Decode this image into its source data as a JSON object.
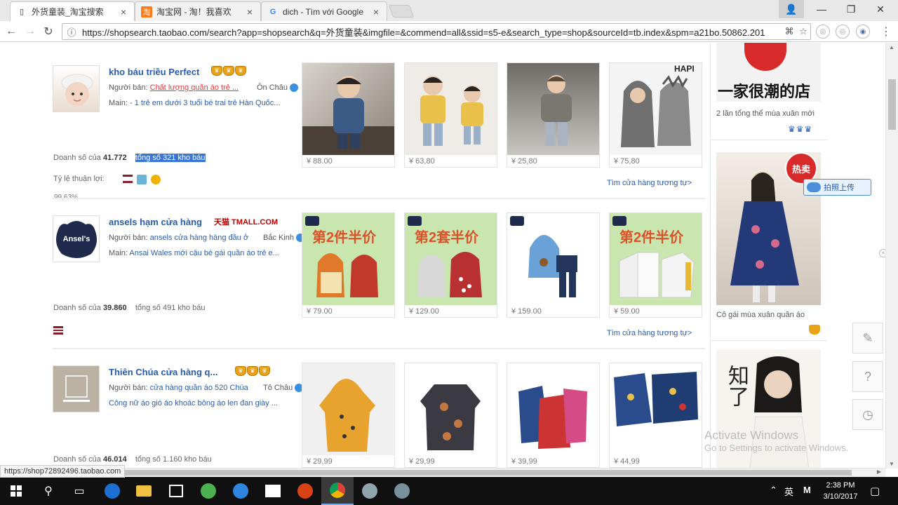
{
  "tabs": [
    {
      "title": "外货童装_淘宝搜索",
      "icon": "page-icon"
    },
    {
      "title": "淘宝网 - 淘！我喜欢",
      "icon": "taobao-icon"
    },
    {
      "title": "dich - Tìm với Google",
      "icon": "google-icon"
    }
  ],
  "address": {
    "url": "https://shopsearch.taobao.com/search?app=shopsearch&q=外货童装&imgfile=&commend=all&ssid=s5-e&search_type=shop&sourceId=tb.index&spm=a21bo.50862.201"
  },
  "shops": [
    {
      "name": "kho báu triều Perfect",
      "seller_label": "Người bán:",
      "seller": "Chất lượng quần áo trẻ ...",
      "location": "Ôn Châu",
      "main_label": "Main:",
      "main": "- 1 trẻ em dưới 3 tuổi bé trai trẻ Hàn Quốc...",
      "sales_label": "Doanh số của",
      "sales": "41.772",
      "total_text": "tổng số 321 kho báu",
      "rate_label": "Tỷ lệ thuận lợi:",
      "rate": "99,63%",
      "similar": "Tìm cửa hàng tương tự>",
      "products": [
        {
          "price": "¥ 88.00",
          "colors": [
            "#6b5a4a",
            "#3c5a86"
          ]
        },
        {
          "price": "¥ 63,80",
          "colors": [
            "#e9c04a",
            "#9ab0c8"
          ]
        },
        {
          "price": "¥ 25,80",
          "colors": [
            "#7a7670",
            "#a9b4c2"
          ]
        },
        {
          "price": "¥ 75,80",
          "colors": [
            "#777777",
            "#d6d6d6"
          ]
        }
      ]
    },
    {
      "name": "ansels hạm cửa hàng",
      "tmall": "天猫 TMALL.COM",
      "logo_text": "Ansel's",
      "seller_label": "Người bán:",
      "seller": "ansels cửa hàng hàng đầu ở",
      "location": "Bắc Kinh",
      "main_label": "Main:",
      "main": "Ansai Wales mới cậu bé gái quần áo trẻ e...",
      "sales_label": "Doanh số của",
      "sales": "39.860",
      "total_text": "tổng số 491 kho báu",
      "similar": "Tìm cửa hàng tương tự>",
      "promo": "第2件半价",
      "promo2": "第2套半价",
      "products": [
        {
          "price": "¥ 79.00",
          "colors": [
            "#bfe0a4",
            "#e07a2a"
          ]
        },
        {
          "price": "¥ 129.00",
          "colors": [
            "#bfe0a4",
            "#c0392b"
          ]
        },
        {
          "price": "¥ 159.00",
          "colors": [
            "#ffffff",
            "#6aa2d8"
          ]
        },
        {
          "price": "¥ 59.00",
          "colors": [
            "#bfe0a4",
            "#f0f0f0"
          ]
        }
      ]
    },
    {
      "name": "Thiên Chúa cửa hàng q...",
      "seller_label": "Người bán:",
      "seller": "cửa hàng quần áo 520 Chúa",
      "location": "Tô Châu",
      "main": "Công nữ áo gió áo khoác bông áo len đan giày ...",
      "sales_label": "Doanh số của",
      "sales": "46.014",
      "total_text": "tổng số 1.160 kho báu",
      "products": [
        {
          "price": "¥ 29,99",
          "colors": [
            "#f0f0f0",
            "#e8a32e"
          ]
        },
        {
          "price": "¥ 29,99",
          "colors": [
            "#ffffff",
            "#3b3a42"
          ]
        },
        {
          "price": "¥ 39,99",
          "colors": [
            "#ffffff",
            "#cc3333"
          ]
        },
        {
          "price": "¥ 44,99",
          "colors": [
            "#ffffff",
            "#2b4c8c"
          ]
        }
      ]
    }
  ],
  "sidebar": {
    "banner_text": "一家很潮的店",
    "items": [
      {
        "caption": "2 lần tổng thể mùa xuân mới"
      },
      {
        "caption": "Cô gái mùa xuân quần áo",
        "badge": "热卖"
      },
      {
        "caption": "",
        "overlay_text": "知了"
      }
    ]
  },
  "upload": {
    "label": "拍照上传"
  },
  "status_url": "https://shop72892496.taobao.com",
  "watermark": {
    "line1": "Activate Windows",
    "line2": "Go to Settings to activate Windows."
  },
  "clock": {
    "time": "2:38 PM",
    "date": "3/10/2017"
  },
  "tray": {
    "ime": "英",
    "m": "M"
  },
  "colors": {
    "link": "#2a5caa",
    "accent": "#ff5000",
    "taskbar": "#101010"
  }
}
